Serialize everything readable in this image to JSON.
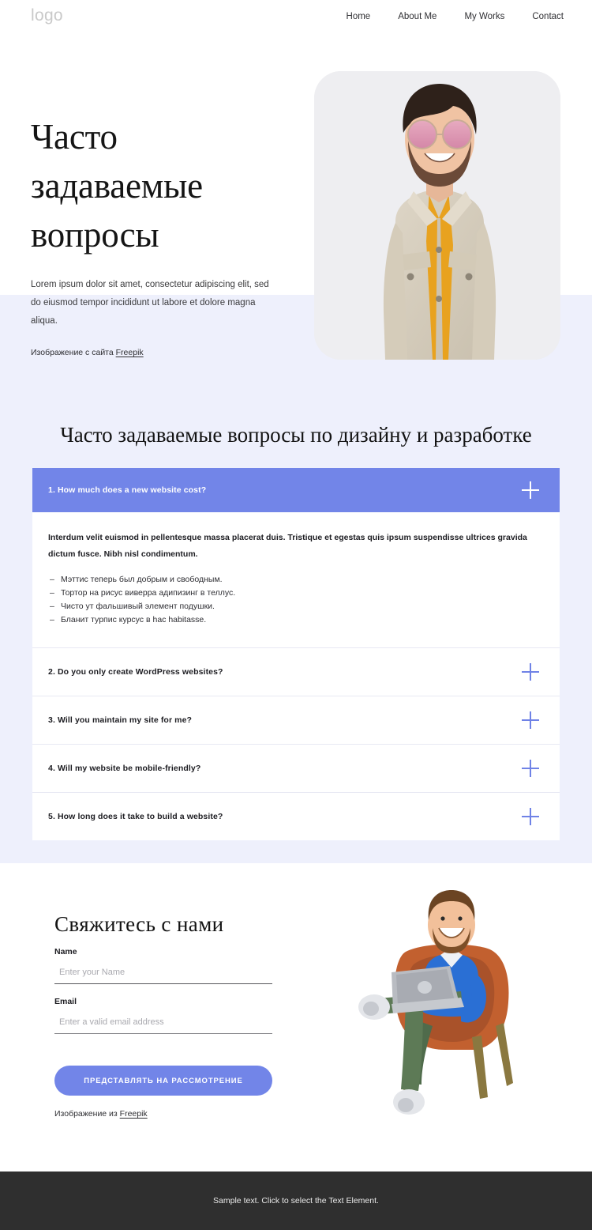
{
  "header": {
    "logo": "logo",
    "nav": [
      {
        "label": "Home"
      },
      {
        "label": "About Me"
      },
      {
        "label": "My Works"
      },
      {
        "label": "Contact"
      }
    ]
  },
  "hero": {
    "title": "Часто задаваемые вопросы",
    "subtitle": "Lorem ipsum dolor sit amet, consectetur adipiscing elit, sed do eiusmod tempor incididunt ut labore et dolore magna aliqua.",
    "credit_prefix": "Изображение с сайта ",
    "credit_link": "Freepik",
    "image_alt": "smiling-man-in-beige-denim-jacket-with-round-pink-sunglasses"
  },
  "faq": {
    "heading": "Часто задаваемые вопросы по дизайну и разработке",
    "items": [
      {
        "question": "1. How much does a new website cost?",
        "open": true,
        "answer_lead": "Interdum velit euismod in pellentesque massa placerat duis. Tristique et egestas quis ipsum suspendisse ultrices gravida dictum fusce. Nibh nisl condimentum.",
        "answer_bullets": [
          "Мэттис теперь был добрым и свободным.",
          "Тортор на рисус виверра адипизинг в теллус.",
          "Чисто ут фальшивый элемент подушки.",
          "Бланит турпис курсус в hac habitasse."
        ]
      },
      {
        "question": "2. Do you only create WordPress websites?",
        "open": false
      },
      {
        "question": "3. Will you maintain my site for me?",
        "open": false
      },
      {
        "question": "4. Will my website be mobile-friendly?",
        "open": false
      },
      {
        "question": "5. How long does it take to build a website?",
        "open": false
      }
    ]
  },
  "contact": {
    "title": "Свяжитесь с нами",
    "name_label": "Name",
    "name_value": "",
    "name_placeholder": "Enter your Name",
    "email_label": "Email",
    "email_value": "",
    "email_placeholder": "Enter a valid email address",
    "submit_label": "ПРЕДСТАВЛЯТЬ НА РАССМОТРЕНИЕ",
    "credit_prefix": "Изображение из ",
    "credit_link": "Freepik",
    "illustration_alt": "3d-character-man-with-laptop-sitting-in-orange-chair"
  },
  "footer": {
    "text": "Sample text. Click to select the Text Element."
  },
  "colors": {
    "accent": "#7285e8",
    "accent_icon": "#6f82e6",
    "band": "#eef0fc",
    "footer_bg": "#2f2f2f",
    "text": "#1d1d22",
    "logo": "#c9c9c9"
  }
}
